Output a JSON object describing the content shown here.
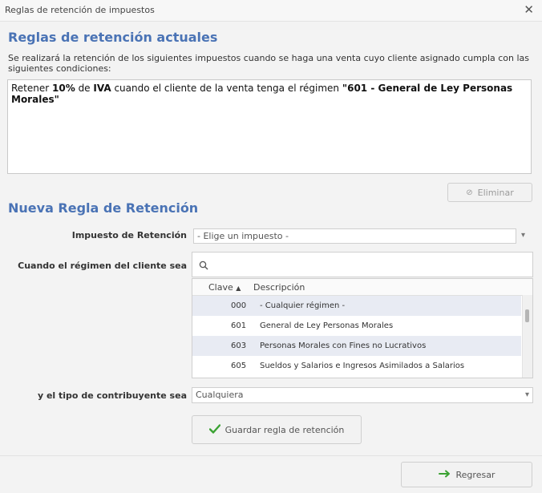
{
  "window": {
    "title": "Reglas de retención de impuestos",
    "close_glyph": "✕"
  },
  "current_rules": {
    "heading": "Reglas de retención actuales",
    "description": "Se realizará la retención de los siguientes impuestos cuando se haga una venta cuyo cliente asignado cumpla con las siguientes condiciones:",
    "rules": [
      {
        "prefix": "Retener ",
        "percent": "10%",
        "mid1": " de ",
        "tax": "IVA",
        "mid2": " cuando el cliente de la venta tenga el régimen ",
        "regime": "\"601 - General de Ley Personas Morales\""
      }
    ],
    "delete_label": "Eliminar"
  },
  "new_rule": {
    "heading": "Nueva Regla de Retención",
    "tax_label": "Impuesto de Retención",
    "tax_value": "- Elige un impuesto -",
    "regime_label": "Cuando el régimen del cliente sea",
    "search_placeholder": "",
    "grid": {
      "col_clave": "Clave",
      "col_desc": "Descripción",
      "rows": [
        {
          "clave": "000",
          "descripcion": "- Cualquier régimen -"
        },
        {
          "clave": "601",
          "descripcion": "General de Ley Personas Morales"
        },
        {
          "clave": "603",
          "descripcion": "Personas Morales con Fines no Lucrativos"
        },
        {
          "clave": "605",
          "descripcion": "Sueldos y Salarios e Ingresos Asimilados a Salarios"
        }
      ]
    },
    "taxpayer_label": "y el tipo de contribuyente sea",
    "taxpayer_value": "Cualquiera",
    "save_label": "Guardar regla de retención"
  },
  "footer": {
    "back_label": "Regresar"
  },
  "colors": {
    "heading": "#4a73b5",
    "check_icon": "#3aa232",
    "arrow_icon": "#3aa232",
    "row_alt": "#e8ebf3"
  }
}
